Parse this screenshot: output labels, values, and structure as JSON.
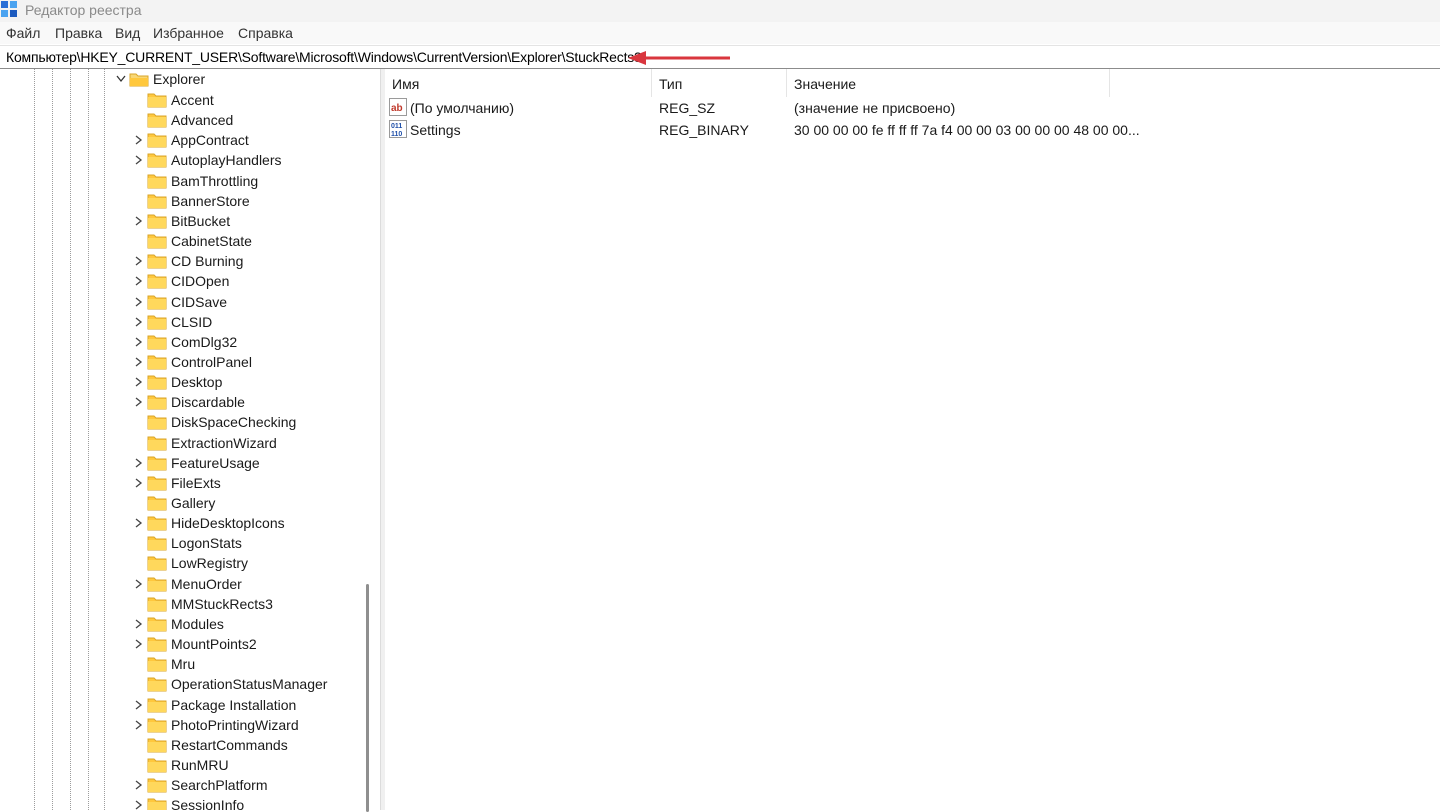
{
  "window": {
    "title": "Редактор реестра",
    "icon": "registry-editor-icon"
  },
  "menu": [
    "Файл",
    "Правка",
    "Вид",
    "Избранное",
    "Справка"
  ],
  "address": {
    "path": "Компьютер\\HKEY_CURRENT_USER\\Software\\Microsoft\\Windows\\CurrentVersion\\Explorer\\StuckRects3"
  },
  "annotation": {
    "arrow_color": "#d9363e"
  },
  "tree": {
    "parent": {
      "label": "Explorer",
      "expanded": true
    },
    "items": [
      {
        "label": "Accent",
        "has_children": false
      },
      {
        "label": "Advanced",
        "has_children": false
      },
      {
        "label": "AppContract",
        "has_children": true
      },
      {
        "label": "AutoplayHandlers",
        "has_children": true
      },
      {
        "label": "BamThrottling",
        "has_children": false
      },
      {
        "label": "BannerStore",
        "has_children": false
      },
      {
        "label": "BitBucket",
        "has_children": true
      },
      {
        "label": "CabinetState",
        "has_children": false
      },
      {
        "label": "CD Burning",
        "has_children": true
      },
      {
        "label": "CIDOpen",
        "has_children": true
      },
      {
        "label": "CIDSave",
        "has_children": true
      },
      {
        "label": "CLSID",
        "has_children": true
      },
      {
        "label": "ComDlg32",
        "has_children": true
      },
      {
        "label": "ControlPanel",
        "has_children": true
      },
      {
        "label": "Desktop",
        "has_children": true
      },
      {
        "label": "Discardable",
        "has_children": true
      },
      {
        "label": "DiskSpaceChecking",
        "has_children": false
      },
      {
        "label": "ExtractionWizard",
        "has_children": false
      },
      {
        "label": "FeatureUsage",
        "has_children": true
      },
      {
        "label": "FileExts",
        "has_children": true
      },
      {
        "label": "Gallery",
        "has_children": false
      },
      {
        "label": "HideDesktopIcons",
        "has_children": true
      },
      {
        "label": "LogonStats",
        "has_children": false
      },
      {
        "label": "LowRegistry",
        "has_children": false
      },
      {
        "label": "MenuOrder",
        "has_children": true
      },
      {
        "label": "MMStuckRects3",
        "has_children": false
      },
      {
        "label": "Modules",
        "has_children": true
      },
      {
        "label": "MountPoints2",
        "has_children": true
      },
      {
        "label": "Mru",
        "has_children": false
      },
      {
        "label": "OperationStatusManager",
        "has_children": false
      },
      {
        "label": "Package Installation",
        "has_children": true
      },
      {
        "label": "PhotoPrintingWizard",
        "has_children": true
      },
      {
        "label": "RestartCommands",
        "has_children": false
      },
      {
        "label": "RunMRU",
        "has_children": false
      },
      {
        "label": "SearchPlatform",
        "has_children": true
      },
      {
        "label": "SessionInfo",
        "has_children": true
      }
    ]
  },
  "list": {
    "columns": {
      "name": "Имя",
      "type": "Тип",
      "value": "Значение"
    },
    "rows": [
      {
        "icon": "string-value-icon",
        "name": "(По умолчанию)",
        "type": "REG_SZ",
        "value": "(значение не присвоено)"
      },
      {
        "icon": "binary-value-icon",
        "name": "Settings",
        "type": "REG_BINARY",
        "value": "30 00 00 00 fe ff ff ff 7a f4 00 00 03 00 00 00 48 00 00..."
      }
    ]
  }
}
